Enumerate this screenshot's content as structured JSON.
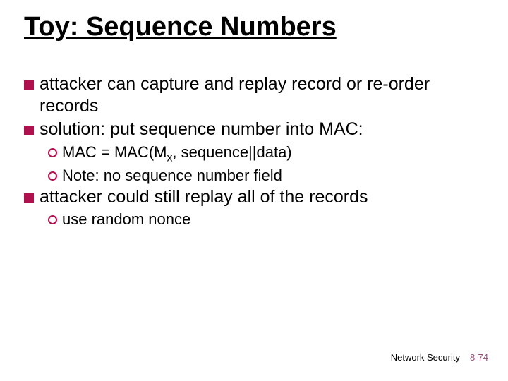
{
  "title": "Toy: Sequence Numbers",
  "bullets": {
    "b1": "attacker can capture and replay record or re-order records",
    "b2": "solution: put sequence number into MAC:",
    "b2s1_pre": "MAC = MAC(M",
    "b2s1_sub": "x",
    "b2s1_post": ", sequence||data)",
    "b2s2": "Note: no sequence number field",
    "b3": "attacker could still replay all of the records",
    "b3s1": "use random nonce"
  },
  "footer": {
    "section": "Network Security",
    "page": "8-74"
  }
}
